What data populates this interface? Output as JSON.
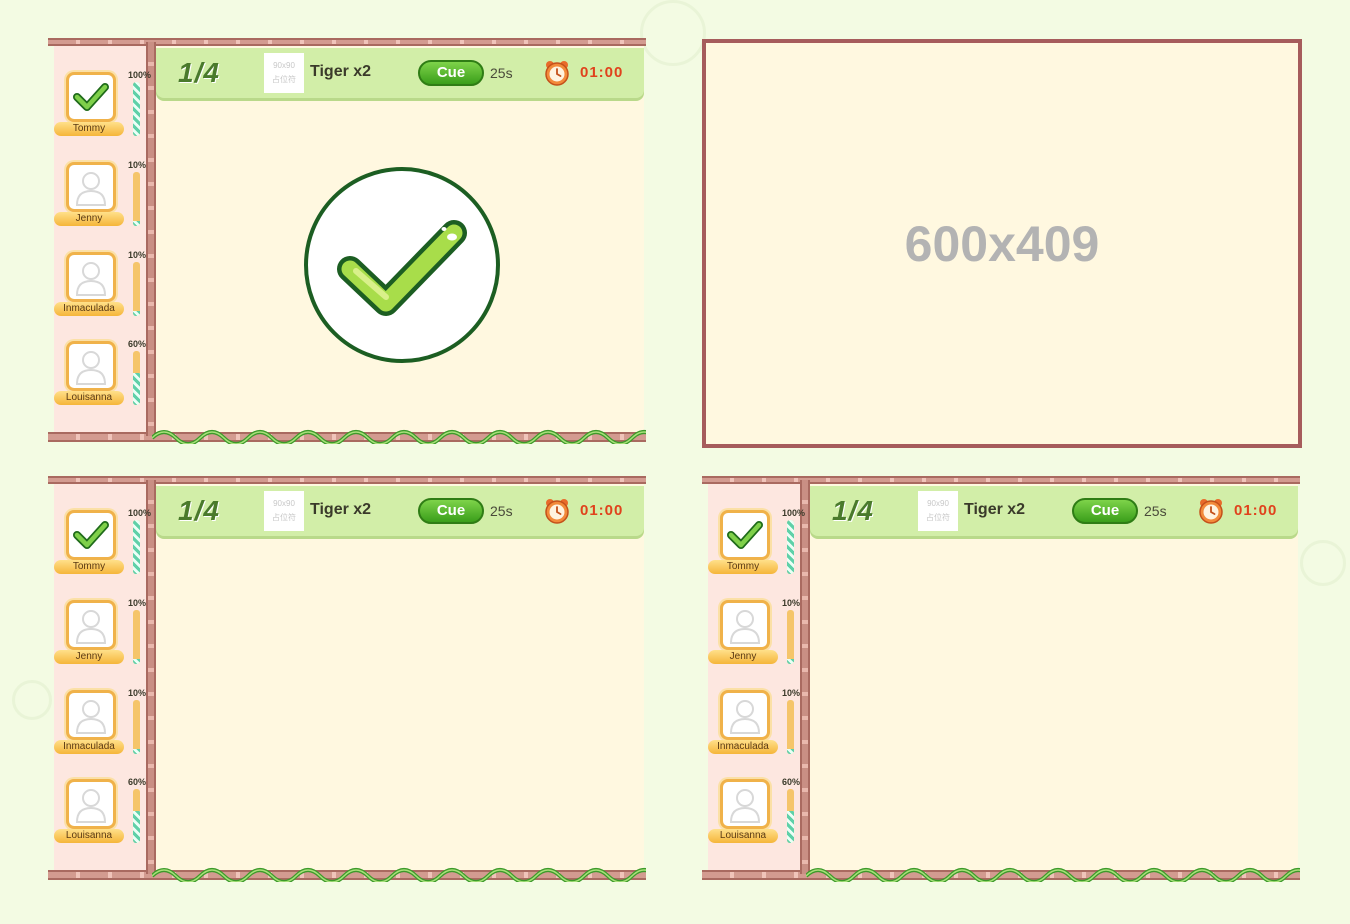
{
  "panels": [
    {
      "counter": "1/4",
      "thumb": "90x90\n占位符",
      "word": "Tiger x2",
      "cue": "Cue",
      "seconds": "25s",
      "timer": "01:00",
      "show_result": true,
      "players": [
        {
          "name": "Tommy",
          "percent": "100%",
          "progress": 1.0,
          "done": true
        },
        {
          "name": "Jenny",
          "percent": "10%",
          "progress": 0.1,
          "done": false
        },
        {
          "name": "Inmaculada",
          "percent": "10%",
          "progress": 0.1,
          "done": false
        },
        {
          "name": "Louisanna",
          "percent": "60%",
          "progress": 0.6,
          "done": false
        }
      ]
    },
    {
      "counter": "1/4",
      "thumb": "90x90\n占位符",
      "word": "Tiger x2",
      "cue": "Cue",
      "seconds": "25s",
      "timer": "01:00",
      "show_result": false,
      "players": [
        {
          "name": "Tommy",
          "percent": "100%",
          "progress": 1.0,
          "done": true
        },
        {
          "name": "Jenny",
          "percent": "10%",
          "progress": 0.1,
          "done": false
        },
        {
          "name": "Inmaculada",
          "percent": "10%",
          "progress": 0.1,
          "done": false
        },
        {
          "name": "Louisanna",
          "percent": "60%",
          "progress": 0.6,
          "done": false
        }
      ]
    },
    {
      "counter": "1/4",
      "thumb": "90x90\n占位符",
      "word": "Tiger x2",
      "cue": "Cue",
      "seconds": "25s",
      "timer": "01:00",
      "show_result": false,
      "players": [
        {
          "name": "Tommy",
          "percent": "100%",
          "progress": 1.0,
          "done": true
        },
        {
          "name": "Jenny",
          "percent": "10%",
          "progress": 0.1,
          "done": false
        },
        {
          "name": "Inmaculada",
          "percent": "10%",
          "progress": 0.1,
          "done": false
        },
        {
          "name": "Louisanna",
          "percent": "60%",
          "progress": 0.6,
          "done": false
        }
      ]
    }
  ],
  "placeholder": {
    "label": "600x409"
  },
  "colors": {
    "background": "#f3fbe3",
    "header": "#d2eea8",
    "content": "#fff8e0",
    "timer": "#e0421c",
    "cue": "#3a9e1a",
    "placeholder_border": "#a65c5c"
  },
  "icons": [
    "check-icon",
    "alarm-clock-icon",
    "user-silhouette-icon"
  ]
}
